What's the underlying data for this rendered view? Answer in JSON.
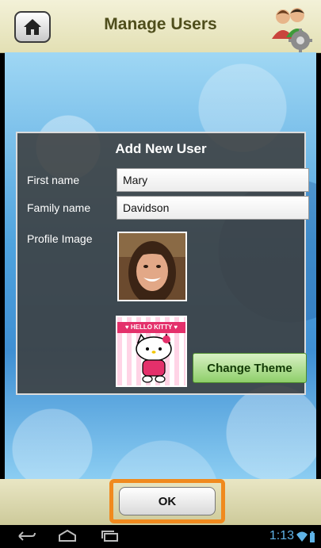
{
  "header": {
    "title": "Manage Users",
    "home_icon": "home-icon",
    "users_icon": "users-settings-icon"
  },
  "dialog": {
    "title": "Add New User",
    "first_name_label": "First name",
    "first_name_value": "Mary",
    "family_name_label": "Family name",
    "family_name_value": "Davidson",
    "profile_image_label": "Profile Image",
    "theme_banner_text": "♥ HELLO KITTY ♥",
    "change_theme_label": "Change Theme"
  },
  "footer": {
    "ok_label": "OK"
  },
  "system_bar": {
    "time": "1:13",
    "icons": [
      "back-icon",
      "home-nav-icon",
      "recent-apps-icon",
      "wifi-icon",
      "battery-icon"
    ]
  },
  "colors": {
    "header_text": "#4f4e1c",
    "focus_outline": "#f08a1e",
    "change_theme_bg": "#8fcf6a",
    "clock": "#5fb3e6"
  }
}
